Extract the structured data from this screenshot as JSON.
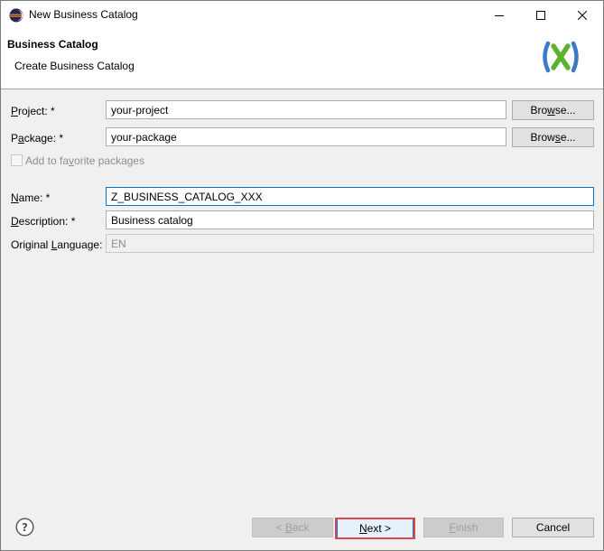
{
  "window": {
    "title": "New Business Catalog",
    "icons": {
      "app": "eclipse-icon",
      "minimize": "minimize-icon",
      "maximize": "maximize-icon",
      "close": "close-icon"
    }
  },
  "banner": {
    "title": "Business Catalog",
    "subtitle": "Create Business Catalog",
    "logo_icon": "abap-x-logo-icon"
  },
  "form": {
    "project": {
      "label_pre": "",
      "label_mnemonic": "P",
      "label_post": "roject: *",
      "value": "your-project",
      "browse_pre": "Bro",
      "browse_mnemonic": "w",
      "browse_post": "se..."
    },
    "package": {
      "label_pre": "P",
      "label_mnemonic": "a",
      "label_post": "ckage: *",
      "value": "your-package",
      "browse_pre": "Brow",
      "browse_mnemonic": "s",
      "browse_post": "e..."
    },
    "favorite": {
      "label_pre": "Add to fa",
      "label_mnemonic": "v",
      "label_post": "orite packages",
      "checked": false
    },
    "name": {
      "label_pre": "",
      "label_mnemonic": "N",
      "label_post": "ame: *",
      "value": "Z_BUSINESS_CATALOG_XXX"
    },
    "description": {
      "label_pre": "",
      "label_mnemonic": "D",
      "label_post": "escription: *",
      "value": "Business catalog"
    },
    "language": {
      "label_pre": "Original ",
      "label_mnemonic": "L",
      "label_post": "anguage:",
      "value": "EN"
    }
  },
  "footer": {
    "help_icon": "help-icon",
    "back": {
      "pre": "< ",
      "mnemonic": "B",
      "post": "ack"
    },
    "next": {
      "pre": "",
      "mnemonic": "N",
      "post": "ext >"
    },
    "finish": {
      "pre": "",
      "mnemonic": "F",
      "post": "inish"
    },
    "cancel": "Cancel"
  },
  "colors": {
    "accent": "#0078d7",
    "highlight": "#e0474c",
    "logo_green": "#5cb130",
    "logo_blue": "#3c7ac6"
  }
}
